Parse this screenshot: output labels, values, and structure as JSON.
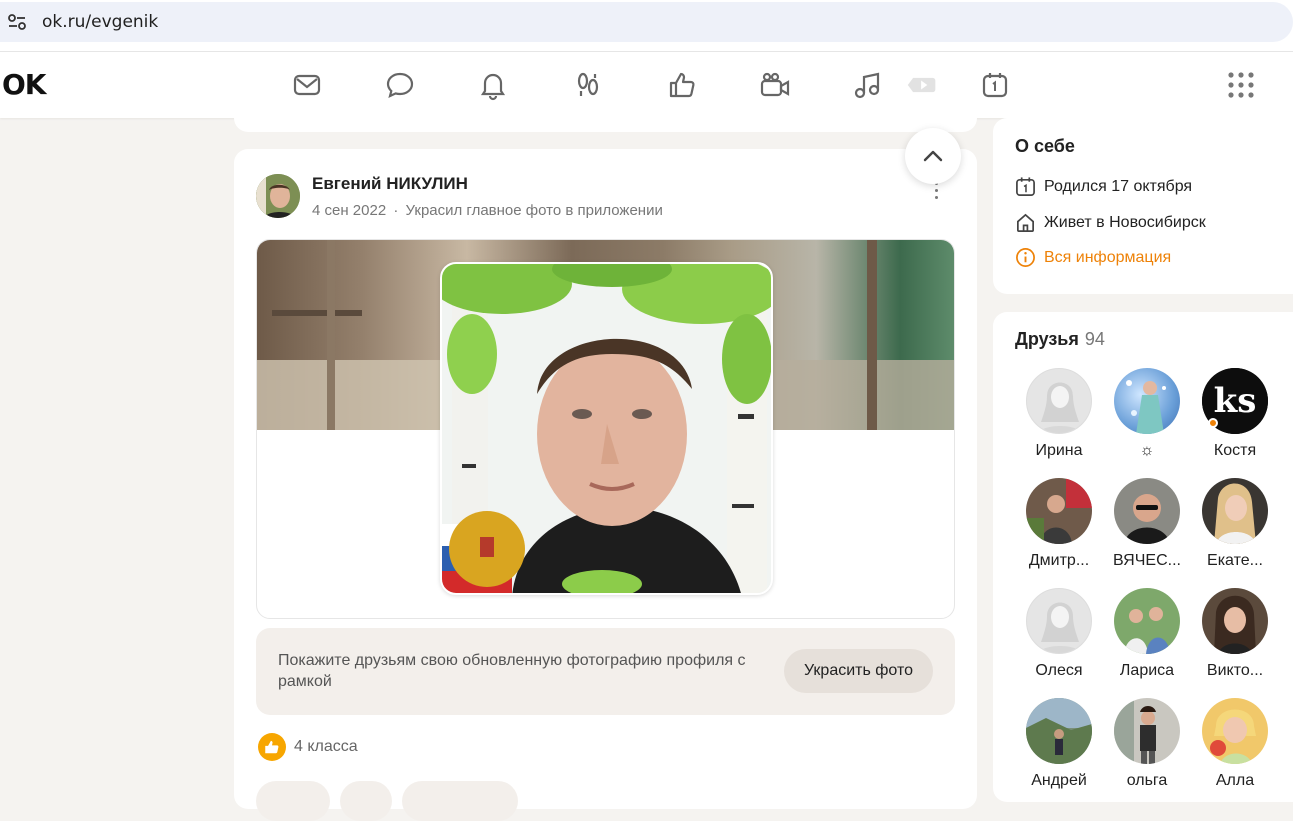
{
  "browser": {
    "url": "ok.ru/evgenik"
  },
  "header": {
    "logo": "OK",
    "icons": [
      "mail-icon",
      "chat-icon",
      "bell-icon",
      "guests-icon",
      "like-icon",
      "video-camera-icon",
      "music-icon",
      "video-play-icon",
      "calendar-icon",
      "apps-grid-icon"
    ]
  },
  "post": {
    "author": "Евгений НИКУЛИН",
    "date": "4 сен 2022",
    "separator": "·",
    "action": "Украсил главное фото в приложении",
    "promo_text": "Покажите друзьям свою обновленную фотографию профиля с рамкой",
    "promo_button": "Украсить фото",
    "likes": "4 класса"
  },
  "about": {
    "title": "О себе",
    "born": "Родился 17 октября",
    "lives": "Живет в Новосибирск",
    "all_info": "Вся информация"
  },
  "friends": {
    "title": "Друзья",
    "count": "94",
    "items": [
      {
        "name": "Ирина"
      },
      {
        "name": "☼"
      },
      {
        "name": "Костя"
      },
      {
        "name": "Дмитр..."
      },
      {
        "name": "ВЯЧЕС..."
      },
      {
        "name": "Екате..."
      },
      {
        "name": "Олеся"
      },
      {
        "name": "Лариса"
      },
      {
        "name": "Викто..."
      },
      {
        "name": "Андрей"
      },
      {
        "name": "ольга"
      },
      {
        "name": "Алла"
      }
    ],
    "kostya_initials": "ks"
  },
  "colors": {
    "accent": "#ee8208",
    "like": "#f7a600",
    "page_bg": "#f5f3f0"
  }
}
